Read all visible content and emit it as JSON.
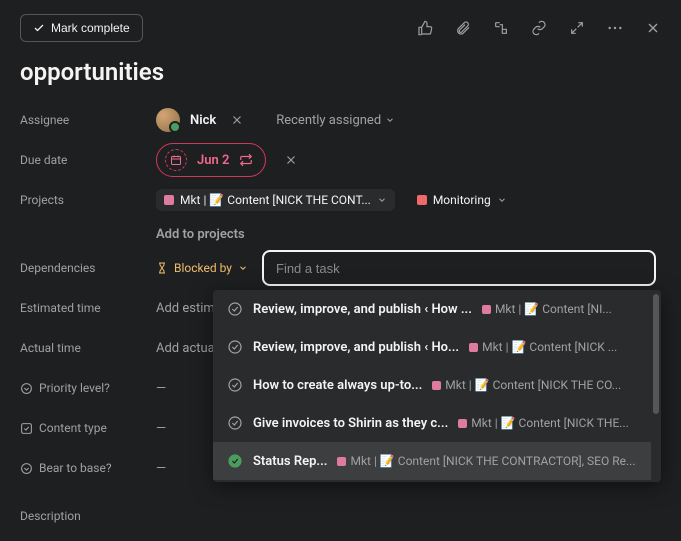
{
  "topbar": {
    "mark_complete": "Mark complete"
  },
  "title": "opportunities",
  "labels": {
    "assignee": "Assignee",
    "due_date": "Due date",
    "projects": "Projects",
    "dependencies": "Dependencies",
    "estimated_time": "Estimated time",
    "actual_time": "Actual time",
    "priority_level": "Priority level?",
    "content_type": "Content type",
    "bear_to_base": "Bear to base?",
    "description": "Description"
  },
  "assignee": {
    "name": "Nick",
    "recently": "Recently assigned"
  },
  "due": {
    "date": "Jun 2"
  },
  "projects": {
    "p1": {
      "label": "Mkt | 📝 Content [NICK THE CONT...",
      "color": "#e07ba0"
    },
    "p2": {
      "label": "Monitoring",
      "color": "#f06a6a"
    },
    "add": "Add to projects"
  },
  "dependencies": {
    "blocked_by": "Blocked by",
    "placeholder": "Find a task"
  },
  "estimated": {
    "add": "Add estimated time"
  },
  "actual": {
    "add": "Add actual time"
  },
  "dash": "—",
  "dropdown": [
    {
      "title": "Review, improve, and publish  ‹ How ...",
      "project": "Mkt | 📝 Content [NI...",
      "done": false
    },
    {
      "title": "Review, improve, and publish  ‹ Ho...",
      "project": "Mkt | 📝 Content [NICK ...",
      "done": false
    },
    {
      "title": "How to create always up-to...",
      "project": "Mkt | 📝 Content [NICK THE CO...",
      "done": false
    },
    {
      "title": "Give invoices to Shirin as they c...",
      "project": "Mkt | 📝 Content [NICK THE...",
      "done": false
    },
    {
      "title": "Status Rep...",
      "project": "Mkt | 📝 Content [NICK THE CONTRACTOR], SEO Re...",
      "done": true
    }
  ]
}
